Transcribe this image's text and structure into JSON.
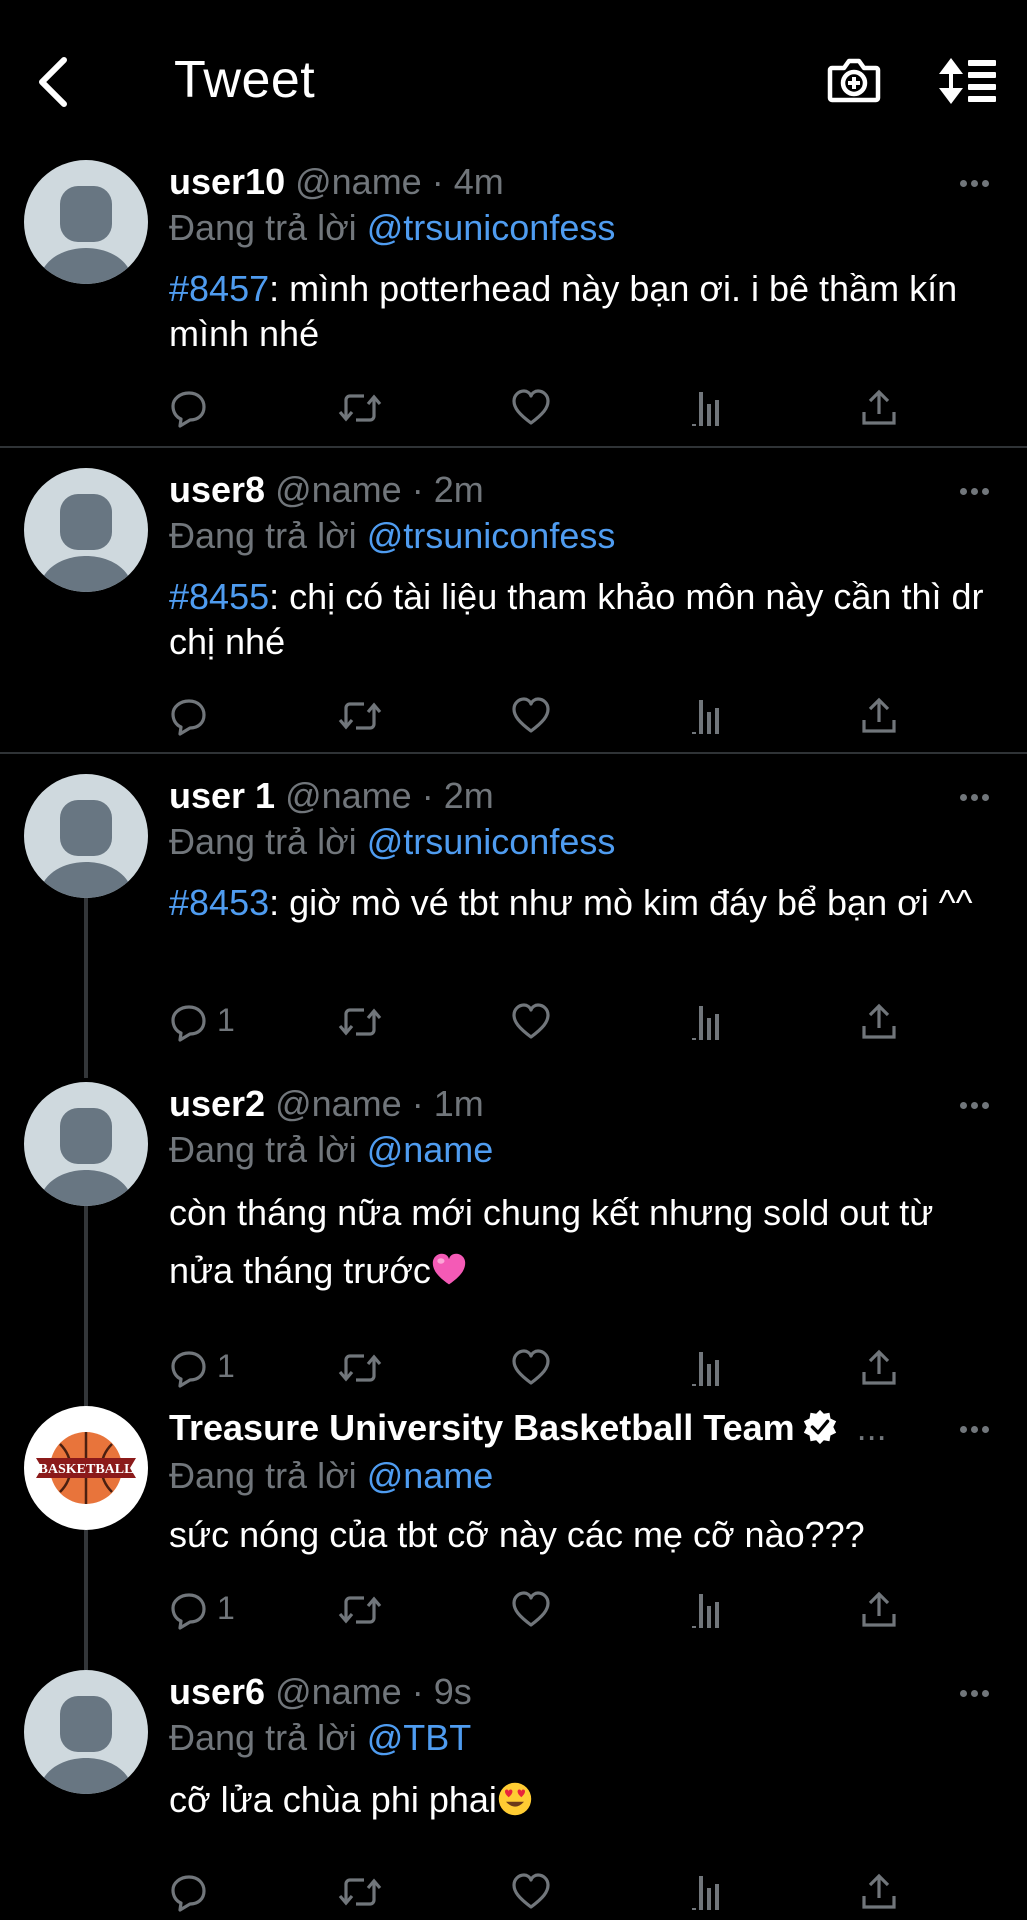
{
  "header": {
    "title": "Tweet",
    "back_icon": "chevron-left-icon",
    "camera_icon": "camera-plus-icon",
    "sort_icon": "sort-icon"
  },
  "colors": {
    "background": "#000000",
    "text": "#ffffff",
    "muted": "#71767b",
    "link": "#4f9cf0",
    "divider": "#2f3336"
  },
  "reply_prefix": "Đang trả lời",
  "tweets": [
    {
      "name": "user10",
      "handle": "@name",
      "separator": "·",
      "time": "4m",
      "reply_to": "@trsuniconfess",
      "hashtag": "#8457",
      "text": ": mình potterhead này bạn ơi. i bê thầm kín mình nhé",
      "reply_count": ""
    },
    {
      "name": "user8",
      "handle": "@name",
      "separator": "·",
      "time": "2m",
      "reply_to": "@trsuniconfess",
      "hashtag": "#8455",
      "text": ": chị có tài liệu tham khảo môn này cần thì dr chị nhé",
      "reply_count": ""
    },
    {
      "name": "user 1",
      "handle": "@name",
      "separator": "·",
      "time": "2m",
      "reply_to": "@trsuniconfess",
      "hashtag": "#8453",
      "text": ": giờ mò vé tbt như mò kim đáy bể bạn ơi ^^",
      "reply_count": "1"
    },
    {
      "name": "user2",
      "handle": "@name",
      "separator": "·",
      "time": "1m",
      "reply_to": "@name",
      "text": "còn tháng nữa mới chung kết nhưng sold out từ nửa tháng trước",
      "emoji": "pink-heart-emoji",
      "reply_count": "1"
    },
    {
      "name": "Treasure University Basketball Team",
      "verified": true,
      "truncation": "...",
      "avatar_label": "BASKETBALL",
      "reply_to": "@name",
      "text": "sức nóng của tbt cỡ này các mẹ cỡ nào???",
      "reply_count": "1"
    },
    {
      "name": "user6",
      "handle": "@name",
      "separator": "·",
      "time": "9s",
      "reply_to": "@TBT",
      "text": "cỡ lửa chùa phi phai",
      "emoji": "heart-eyes-emoji",
      "reply_count": ""
    }
  ]
}
